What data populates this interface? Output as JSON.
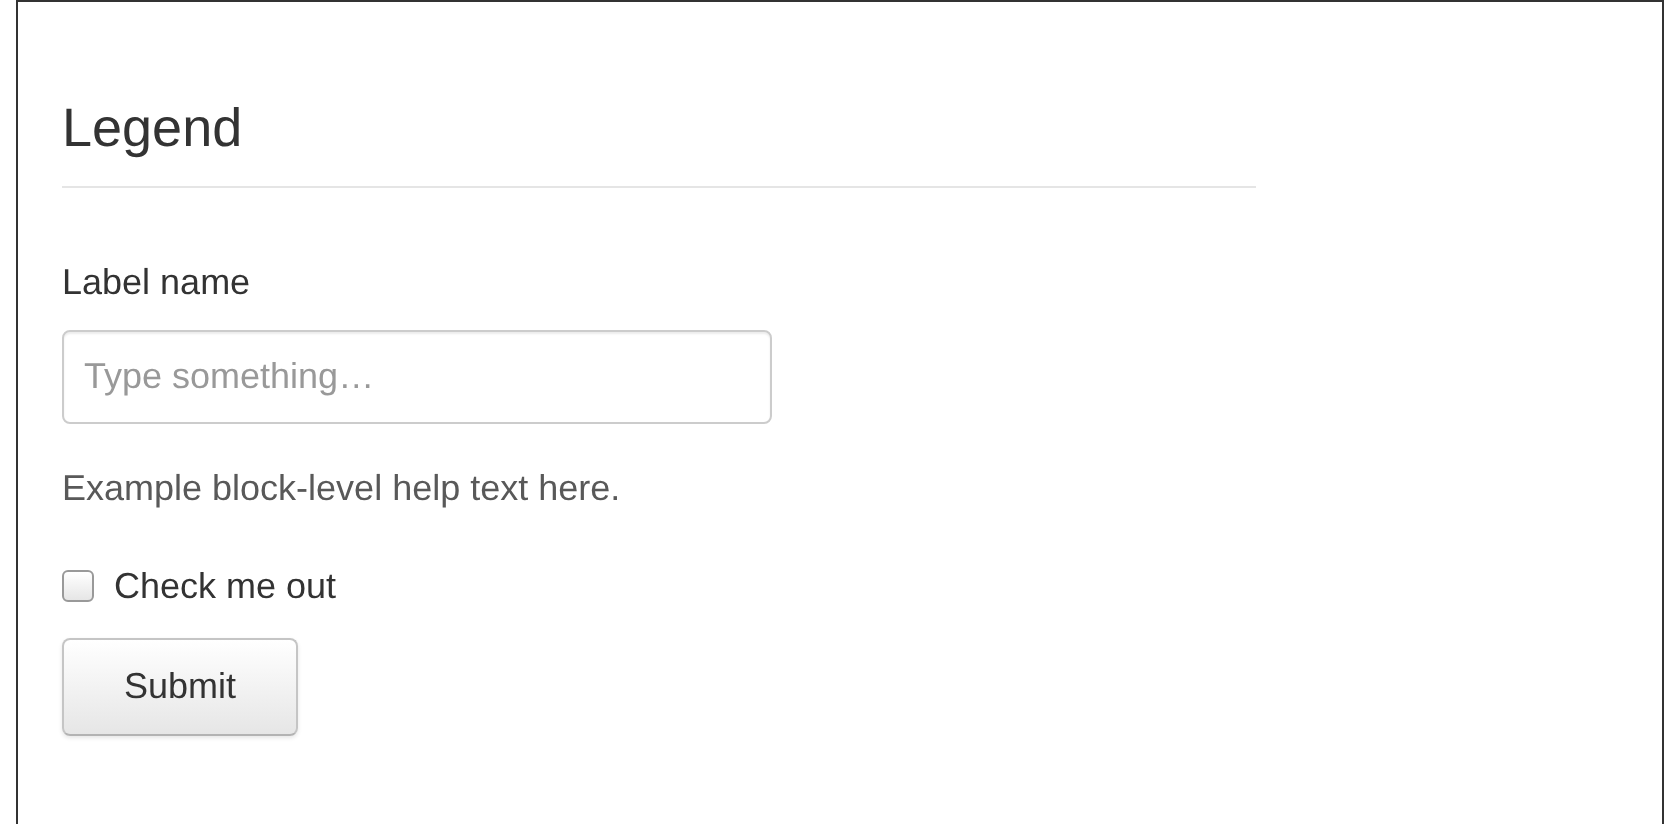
{
  "legend": "Legend",
  "field": {
    "label": "Label name",
    "placeholder": "Type something…"
  },
  "help_text": "Example block-level help text here.",
  "checkbox": {
    "label": "Check me out",
    "checked": false
  },
  "submit": {
    "label": "Submit"
  }
}
